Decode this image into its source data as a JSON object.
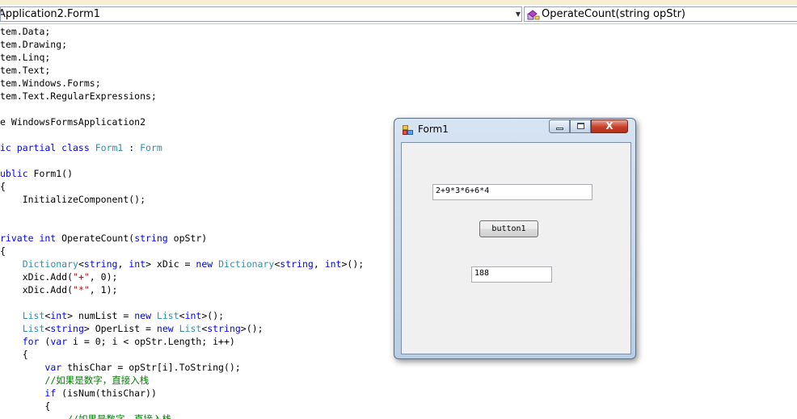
{
  "nav": {
    "class_dropdown": "Application2.Form1",
    "member_dropdown": "OperateCount(string opStr)"
  },
  "icons": {
    "class_arrow": "chevron-down-icon",
    "member_icon": "method-icon",
    "app_icon": "form-window-icon"
  },
  "colors": {
    "keyword": "#0000ff",
    "type": "#2b91af",
    "string": "#a31515",
    "comment": "#008000",
    "close_button": "#c7402a"
  },
  "code_lines": [
    [
      [
        "tem.Data;",
        ""
      ]
    ],
    [
      [
        "tem.Drawing;",
        ""
      ]
    ],
    [
      [
        "tem.Linq;",
        ""
      ]
    ],
    [
      [
        "tem.Text;",
        ""
      ]
    ],
    [
      [
        "tem.Windows.Forms;",
        ""
      ]
    ],
    [
      [
        "tem.Text.RegularExpressions;",
        ""
      ]
    ],
    [],
    [
      [
        "e WindowsFormsApplication2",
        ""
      ]
    ],
    [],
    [
      [
        "ic partial class ",
        "kw"
      ],
      [
        "Form1",
        "ty"
      ],
      [
        " : ",
        ""
      ],
      [
        "Form",
        "ty"
      ]
    ],
    [],
    [
      [
        "ublic",
        "kw"
      ],
      [
        " Form1()",
        ""
      ]
    ],
    [
      [
        "{",
        ""
      ]
    ],
    [
      [
        "    InitializeComponent();",
        ""
      ]
    ],
    [],
    [],
    [
      [
        "rivate int",
        "kw"
      ],
      [
        " OperateCount(",
        ""
      ],
      [
        "string",
        "kw"
      ],
      [
        " opStr)",
        ""
      ]
    ],
    [
      [
        "{",
        ""
      ]
    ],
    [
      [
        "    ",
        ""
      ],
      [
        "Dictionary",
        "ty"
      ],
      [
        "<",
        ""
      ],
      [
        "string",
        "kw"
      ],
      [
        ", ",
        ""
      ],
      [
        "int",
        "kw"
      ],
      [
        "> xDic = ",
        ""
      ],
      [
        "new ",
        "kw"
      ],
      [
        "Dictionary",
        "ty"
      ],
      [
        "<",
        ""
      ],
      [
        "string",
        "kw"
      ],
      [
        ", ",
        ""
      ],
      [
        "int",
        "kw"
      ],
      [
        ">();",
        ""
      ]
    ],
    [
      [
        "    xDic.Add(",
        ""
      ],
      [
        "\"+\"",
        "st"
      ],
      [
        ", 0);",
        ""
      ]
    ],
    [
      [
        "    xDic.Add(",
        ""
      ],
      [
        "\"*\"",
        "st"
      ],
      [
        ", 1);",
        ""
      ]
    ],
    [],
    [
      [
        "    ",
        ""
      ],
      [
        "List",
        "ty"
      ],
      [
        "<",
        ""
      ],
      [
        "int",
        "kw"
      ],
      [
        "> numList = ",
        ""
      ],
      [
        "new ",
        "kw"
      ],
      [
        "List",
        "ty"
      ],
      [
        "<",
        ""
      ],
      [
        "int",
        "kw"
      ],
      [
        ">();",
        ""
      ]
    ],
    [
      [
        "    ",
        ""
      ],
      [
        "List",
        "ty"
      ],
      [
        "<",
        ""
      ],
      [
        "string",
        "kw"
      ],
      [
        "> OperList = ",
        ""
      ],
      [
        "new ",
        "kw"
      ],
      [
        "List",
        "ty"
      ],
      [
        "<",
        ""
      ],
      [
        "string",
        "kw"
      ],
      [
        ">();",
        ""
      ]
    ],
    [
      [
        "    ",
        ""
      ],
      [
        "for",
        "kw"
      ],
      [
        " (",
        ""
      ],
      [
        "var",
        "kw"
      ],
      [
        " i = 0; i < opStr.Length; i++)",
        ""
      ]
    ],
    [
      [
        "    {",
        ""
      ]
    ],
    [
      [
        "        ",
        ""
      ],
      [
        "var",
        "kw"
      ],
      [
        " thisChar = opStr[i].ToString();",
        ""
      ]
    ],
    [
      [
        "        ",
        ""
      ],
      [
        "//如果是数字，直接入栈",
        "cm"
      ]
    ],
    [
      [
        "        ",
        ""
      ],
      [
        "if",
        "kw"
      ],
      [
        " (isNum(thisChar))",
        ""
      ]
    ],
    [
      [
        "        {",
        ""
      ]
    ],
    [
      [
        "            ",
        ""
      ],
      [
        "//如果是数字，直接入栈",
        "cm"
      ]
    ]
  ],
  "form": {
    "title": "Form1",
    "close_label": "X",
    "input_value": "2+9*3*6+6*4",
    "button_label": "button1",
    "result_value": "188"
  }
}
